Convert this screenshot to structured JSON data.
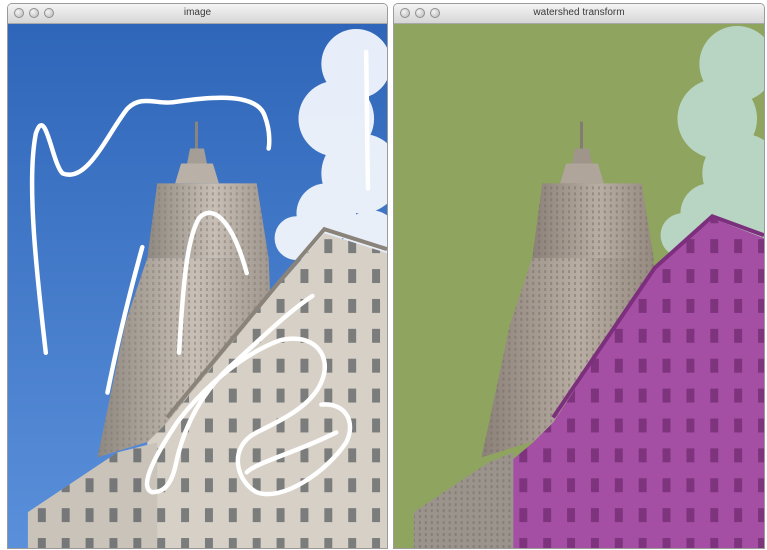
{
  "windows": {
    "left": {
      "title": "image",
      "controls": [
        "close-button",
        "minimize-button",
        "zoom-button"
      ]
    },
    "right": {
      "title": "watershed transform",
      "controls": [
        "close-button",
        "minimize-button",
        "zoom-button"
      ]
    }
  },
  "colors": {
    "sky": "#3f78c7",
    "cloud": "#eef3fb",
    "tower": "#b8b0a8",
    "building": "#cfc9c0",
    "scribble": "#ffffff",
    "segment_sky": "#8ea463",
    "segment_cloud": "#b9d7c4",
    "segment_building": "#a24ea2"
  }
}
